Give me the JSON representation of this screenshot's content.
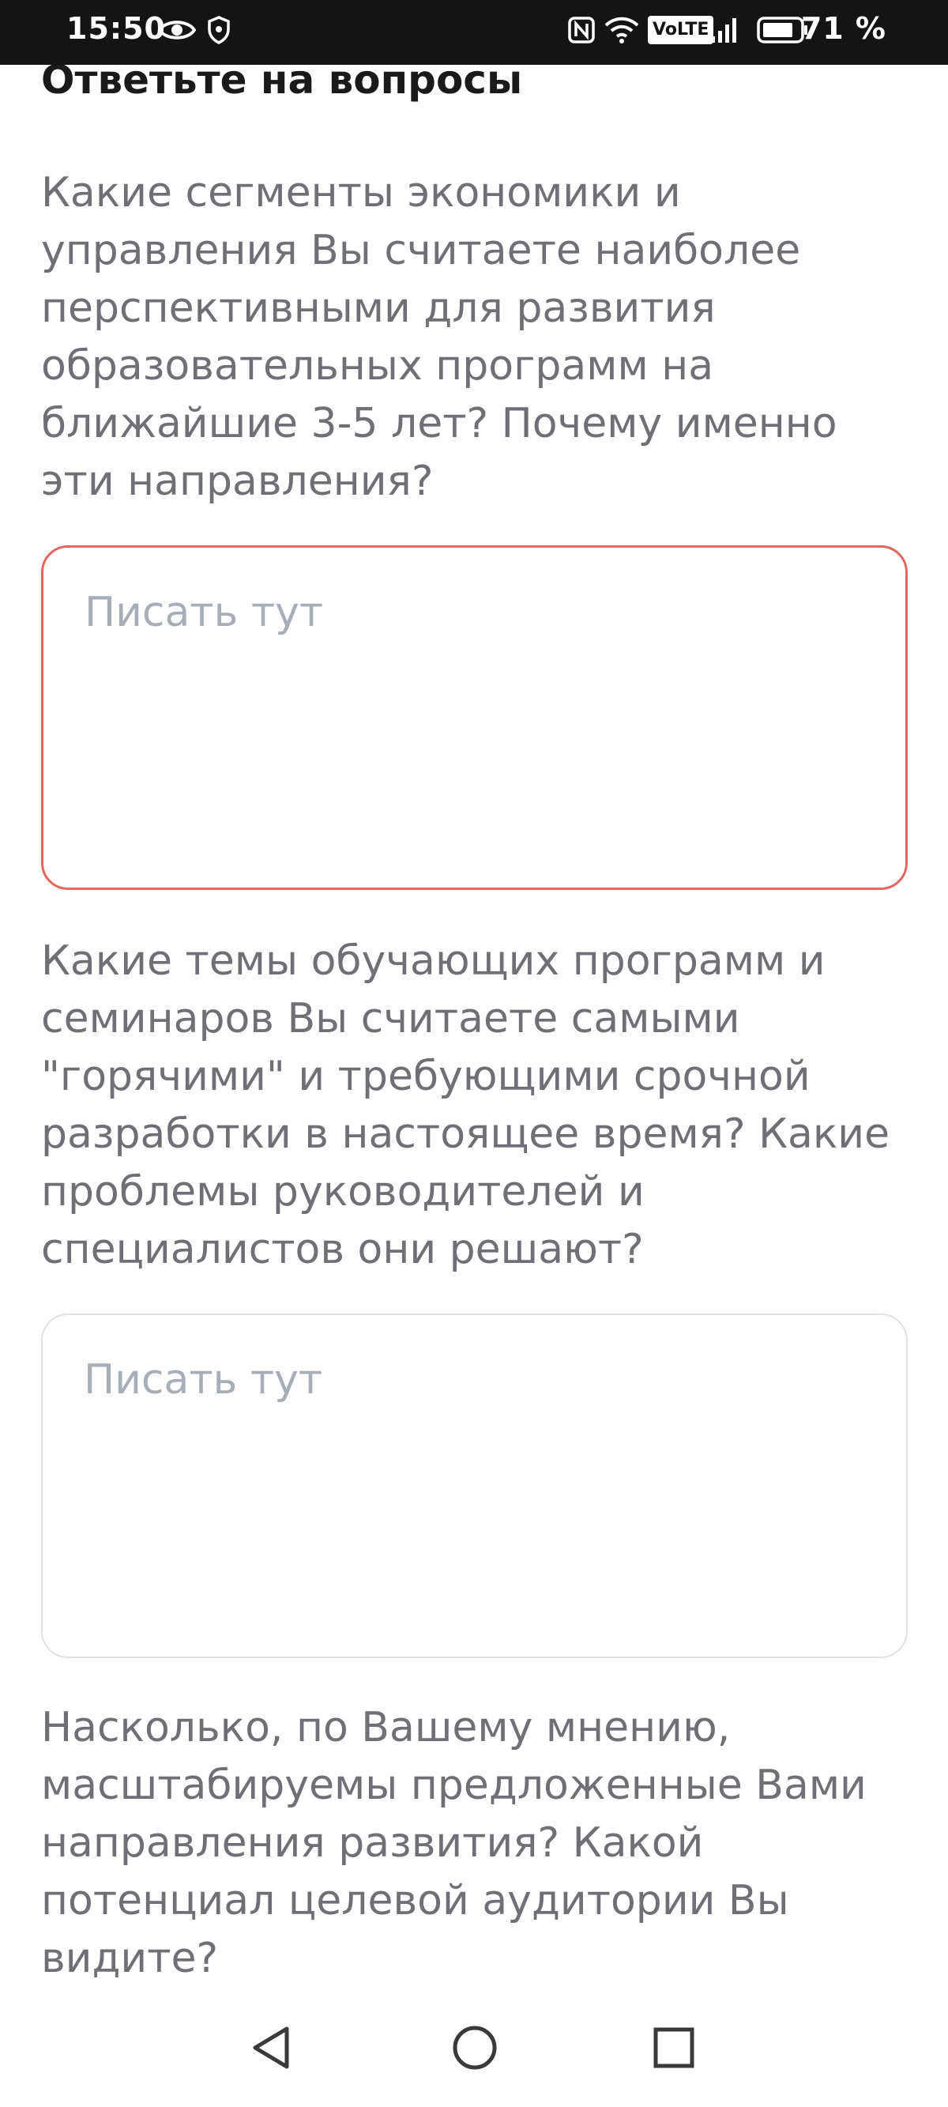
{
  "status_bar": {
    "time": "15:50",
    "network_badge": "VoLTE",
    "battery_percent": "71 %",
    "icons": [
      "eye-icon",
      "vpn-shield-icon",
      "nfc-icon",
      "wifi-icon",
      "volte-icon",
      "signal-icon",
      "battery-icon"
    ]
  },
  "form": {
    "section_title": "Ответьте на вопросы",
    "questions": [
      {
        "text": "Какие сегменты экономики и управления Вы считаете наиболее перспективными для развития образовательных программ на ближайшие 3-5 лет? Почему именно эти направления?",
        "placeholder": "Писать тут",
        "value": "",
        "state": "error"
      },
      {
        "text": "Какие темы обучающих программ и семинаров Вы считаете самыми \"горячими\" и требующими срочной разработки в настоящее время? Какие проблемы руководителей и специалистов они решают?",
        "placeholder": "Писать тут",
        "value": "",
        "state": "default"
      },
      {
        "text": "Насколько, по Вашему мнению, масштабируемы предложенные Вами направления развития? Какой потенциал целевой аудитории Вы видите?"
      }
    ]
  },
  "colors": {
    "status_bar_bg": "#141414",
    "question_text": "#6f7075",
    "placeholder": "#a8aeb8",
    "error_border": "#e4675f",
    "default_border": "#dfe1e5"
  },
  "nav_bar": {
    "buttons": [
      "back-icon",
      "home-icon",
      "recents-icon"
    ]
  }
}
